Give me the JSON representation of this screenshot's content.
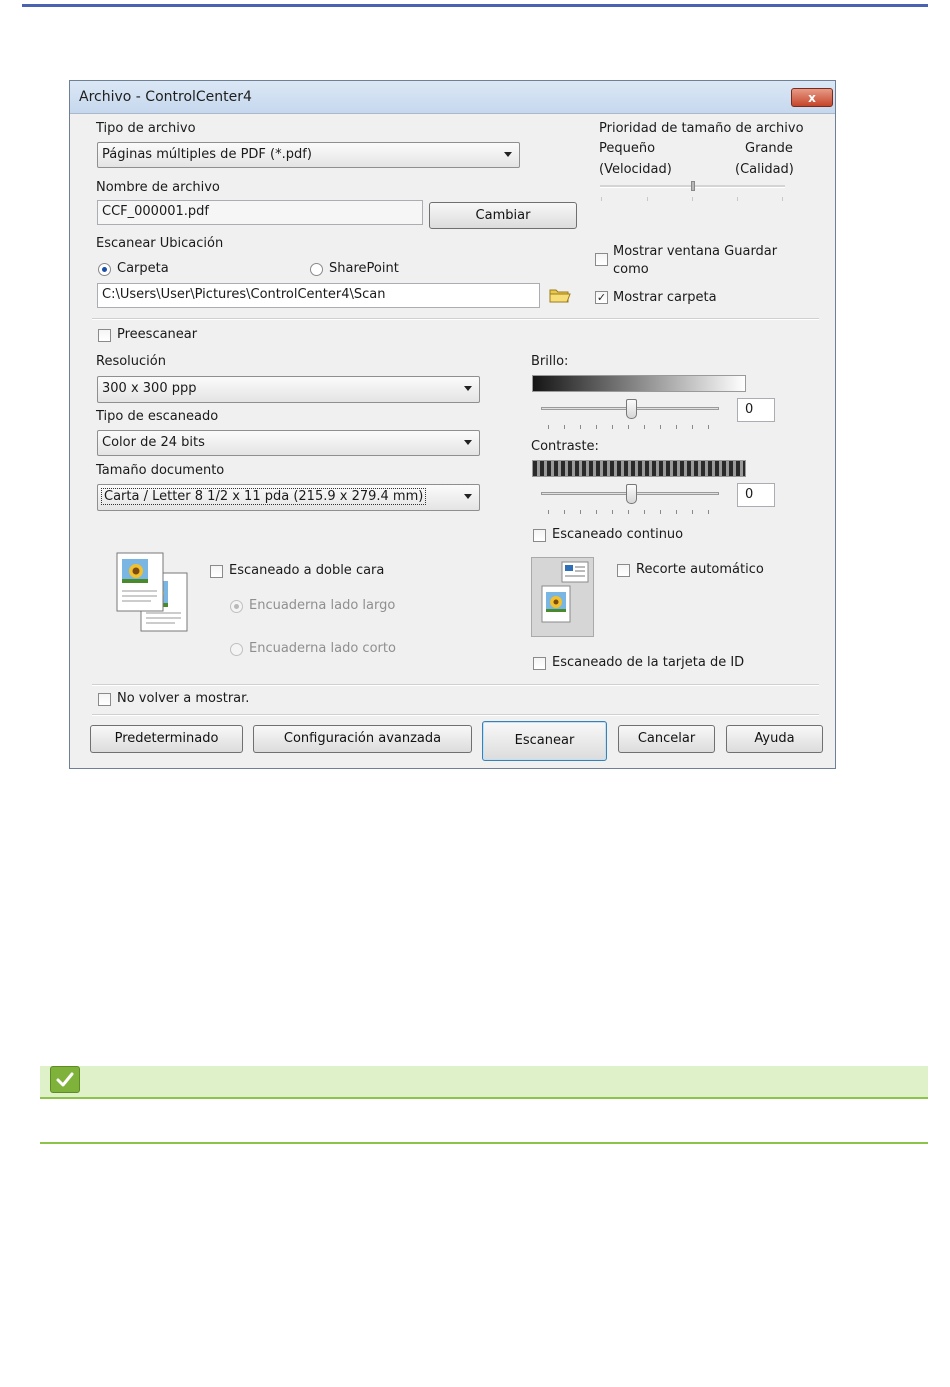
{
  "window": {
    "title": "Archivo - ControlCenter4",
    "close_label": "x"
  },
  "file_type": {
    "label": "Tipo de archivo",
    "value": "Páginas múltiples de PDF (*.pdf)"
  },
  "file_size_priority": {
    "label": "Prioridad de tamaño de archivo",
    "small": "Pequeño",
    "large": "Grande",
    "speed": "(Velocidad)",
    "quality": "(Calidad)"
  },
  "file_name": {
    "label": "Nombre de archivo",
    "value": "CCF_000001.pdf",
    "change_button": "Cambiar"
  },
  "scan_location": {
    "label": "Escanear Ubicación",
    "folder_option": "Carpeta",
    "sharepoint_option": "SharePoint",
    "path": "C:\\Users\\User\\Pictures\\ControlCenter4\\Scan",
    "selected": "Carpeta"
  },
  "show_save_as": {
    "label_line1": "Mostrar ventana Guardar",
    "label_line2": "como",
    "checked": false
  },
  "show_folder": {
    "label": "Mostrar carpeta",
    "checked": true
  },
  "prescan": {
    "label": "Preescanear",
    "checked": false
  },
  "resolution": {
    "label": "Resolución",
    "value": "300 x 300 ppp"
  },
  "scan_type": {
    "label": "Tipo de escaneado",
    "value": "Color de 24 bits"
  },
  "document_size": {
    "label": "Tamaño documento",
    "value": "Carta / Letter 8 1/2 x 11 pda (215.9 x 279.4 mm)"
  },
  "brightness": {
    "label": "Brillo:",
    "value": "0"
  },
  "contrast": {
    "label": "Contraste:",
    "value": "0"
  },
  "continuous_scan": {
    "label": "Escaneado continuo",
    "checked": false
  },
  "duplex": {
    "label": "Escaneado a doble cara",
    "checked": false,
    "long_edge": "Encuaderna lado largo",
    "short_edge": "Encuaderna lado corto"
  },
  "auto_crop": {
    "label": "Recorte automático",
    "checked": false
  },
  "id_card_scan": {
    "label": "Escaneado de la tarjeta de ID",
    "checked": false
  },
  "dont_show_again": {
    "label": "No volver a mostrar.",
    "checked": false
  },
  "buttons": {
    "default": "Predeterminado",
    "advanced": "Configuración avanzada",
    "scan": "Escanear",
    "cancel": "Cancelar",
    "help": "Ayuda"
  },
  "colors": {
    "page_top_bar": "#4a63b0",
    "note_bar": "#dff1c8",
    "note_line": "#8cc449",
    "note_icon": "#7eb23a"
  },
  "icons": {
    "note": "checkmark-icon",
    "folder": "folder-icon",
    "duplex": "duplex-pages-icon",
    "auto_crop": "auto-crop-icon"
  }
}
